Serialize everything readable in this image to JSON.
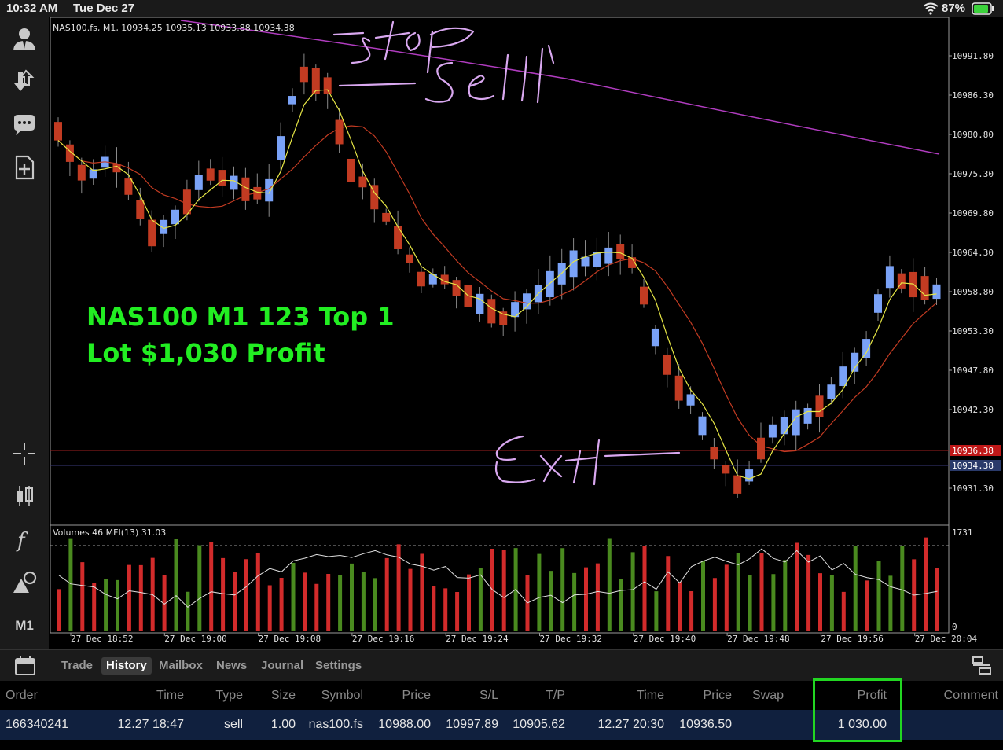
{
  "status_bar": {
    "time": "10:32 AM",
    "date": "Tue Dec 27",
    "battery": "87%"
  },
  "colors": {
    "bull": "#7aa2f7",
    "bear": "#c23b22",
    "vol_up": "#4a8a1f",
    "vol_down": "#d22b2b",
    "ma_fast": "#e6e645",
    "ma_mid": "#c23b22",
    "ma_slow": "#b03cbf",
    "annotation": "#d9a8f0",
    "highlight": "#22d622"
  },
  "chart": {
    "info_line": "NAS100.fs, M1, 10934.25 10935.13 10933.88 10934.38",
    "price_labels": [
      "10991.80",
      "10986.30",
      "10980.80",
      "10975.30",
      "10969.80",
      "10964.30",
      "10958.80",
      "10953.30",
      "10947.80",
      "10942.30",
      "10931.30"
    ],
    "current_price_red": "10936.38",
    "current_price_blue": "10934.38",
    "volume_header": "Volumes 46 MFI(13) 31.03",
    "volume_axis_top": "1731",
    "volume_axis_bottom": "0",
    "time_labels": [
      "27 Dec 18:52",
      "27 Dec 19:00",
      "27 Dec 19:08",
      "27 Dec 19:16",
      "27 Dec 19:24",
      "27 Dec 19:32",
      "27 Dec 19:40",
      "27 Dec 19:48",
      "27 Dec 19:56",
      "27 Dec 20:04"
    ],
    "overlay_line1": "NAS100 M1 123 Top 1",
    "overlay_line2": "Lot $1,030 Profit"
  },
  "left_toolbar": [
    "account-icon",
    "trade-icon",
    "chat-icon",
    "new-order-icon",
    "crosshair-icon",
    "candles-icon",
    "indicators-icon",
    "objects-icon"
  ],
  "timeframe": "M1",
  "tabs": [
    "Trade",
    "History",
    "Mailbox",
    "News",
    "Journal",
    "Settings"
  ],
  "active_tab": "History",
  "history": {
    "headers": [
      "Order",
      "Time",
      "Type",
      "Size",
      "Symbol",
      "Price",
      "S/L",
      "T/P",
      "Time",
      "Price",
      "Swap",
      "Profit",
      "Comment"
    ],
    "row": [
      "166340241",
      "12.27 18:47",
      "sell",
      "1.00",
      "nas100.fs",
      "10988.00",
      "10997.89",
      "10905.62",
      "12.27 20:30",
      "10936.50",
      "",
      "1 030.00",
      ""
    ]
  }
}
